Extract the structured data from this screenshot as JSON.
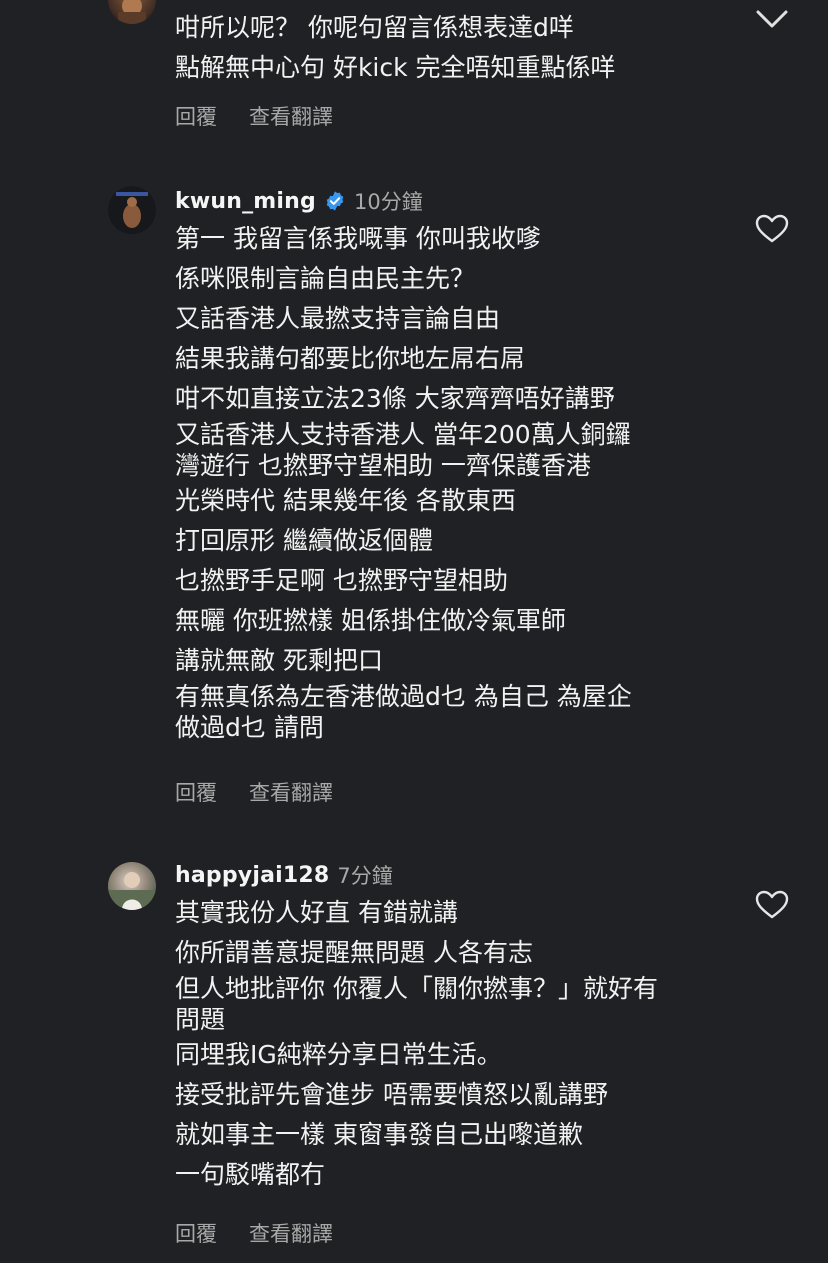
{
  "comments": [
    {
      "lines": [
        "咁所以呢？ 你呢句留言係想表達d咩",
        "點解無中心句 好kick 完全唔知重點係咩"
      ],
      "reply_label": "回覆",
      "translate_label": "查看翻譯"
    },
    {
      "username": "kwun_ming",
      "time": "10分鐘",
      "lines": [
        "第一 我留言係我嘅事 你叫我收嗲",
        "係咪限制言論自由民主先？",
        "又話香港人最撚支持言論自由",
        "結果我講句都要比你地左屌右屌",
        "咁不如直接立法23條 大家齊齊唔好講野",
        "又話香港人支持香港人 當年200萬人銅鑼",
        "灣遊行 乜撚野守望相助 一齊保護香港",
        "光榮時代 結果幾年後 各散東西",
        "打回原形 繼續做返個體",
        "乜撚野手足啊 乜撚野守望相助",
        "無曬 你班撚樣 姐係掛住做冷氣軍師",
        "講就無敵 死剩把口",
        "有無真係為左香港做過d乜 為自己 為屋企",
        "做過d乜 請問"
      ],
      "reply_label": "回覆",
      "translate_label": "查看翻譯"
    },
    {
      "username": "happyjai128",
      "time": "7分鐘",
      "lines": [
        "其實我份人好直 有錯就講",
        "你所謂善意提醒無問題 人各有志",
        "但人地批評你 你覆人「關你撚事？」就好有",
        "問題",
        "同埋我IG純粹分享日常生活。",
        "接受批評先會進步 唔需要憤怒以亂講野",
        "就如事主一樣 東窗事發自己出嚟道歉",
        "一句駁嘴都冇"
      ],
      "reply_label": "回覆",
      "translate_label": "查看翻譯"
    }
  ],
  "icons": {
    "like": "heart-icon",
    "collapse": "chevron-down-icon",
    "verified": "verified-badge-icon"
  },
  "colors": {
    "background": "#202124",
    "text": "#f5f5f5",
    "muted": "#a8a8a8",
    "verified": "#3897f0"
  }
}
